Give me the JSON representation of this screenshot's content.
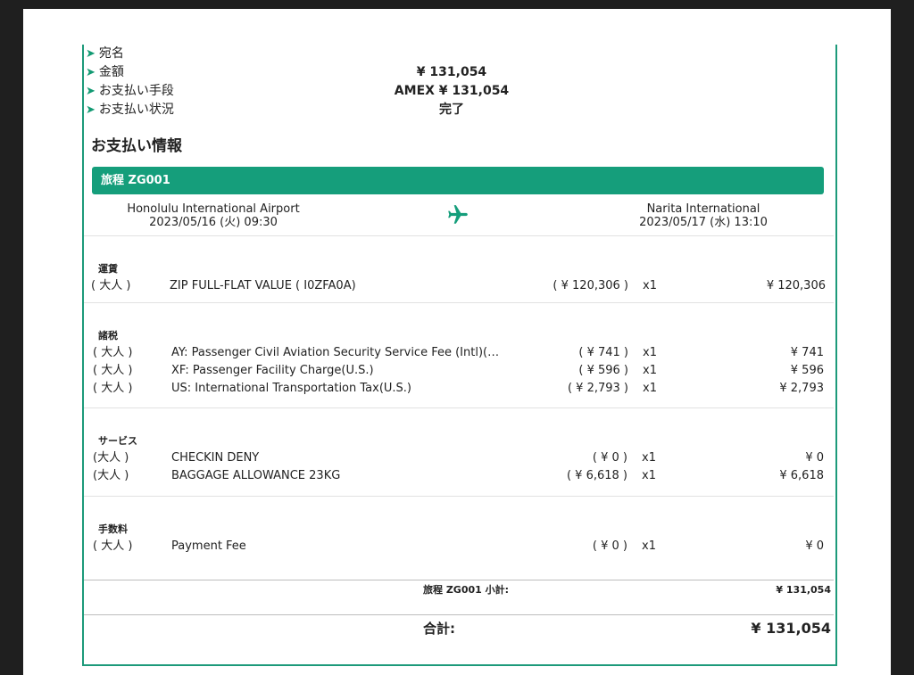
{
  "summary": {
    "rows": [
      {
        "label": "宛名",
        "value": ""
      },
      {
        "label": "金額",
        "value": "¥ 131,054"
      },
      {
        "label": "お支払い手段",
        "value": "AMEX ¥ 131,054"
      },
      {
        "label": "お支払い状況",
        "value": "完了"
      }
    ]
  },
  "section_title": "お支払い情報",
  "itinerary": {
    "title": "旅程 ZG001",
    "origin": {
      "airport": "Honolulu International Airport",
      "datetime": "2023/05/16 (火) 09:30"
    },
    "destination": {
      "airport": "Narita International",
      "datetime": "2023/05/17 (水) 13:10"
    },
    "plane_icon": "airplane-icon"
  },
  "fare": {
    "title": "運賃",
    "rows": [
      {
        "pax": "( 大人 )",
        "desc": "ZIP FULL-FLAT VALUE ( I0ZFA0A)",
        "unit": "( ¥ 120,306 )",
        "qty": "x1",
        "amount": "¥ 120,306"
      }
    ]
  },
  "taxes": {
    "title": "諸税",
    "rows": [
      {
        "pax": "( 大人 )",
        "desc": "AY: Passenger Civil Aviation Security Service Fee (Intl)(…",
        "unit": "( ¥ 741 )",
        "qty": "x1",
        "amount": "¥ 741"
      },
      {
        "pax": "( 大人 )",
        "desc": "XF: Passenger Facility Charge(U.S.)",
        "unit": "( ¥ 596 )",
        "qty": "x1",
        "amount": "¥ 596"
      },
      {
        "pax": "( 大人 )",
        "desc": "US: International Transportation Tax(U.S.)",
        "unit": "( ¥ 2,793 )",
        "qty": "x1",
        "amount": "¥ 2,793"
      }
    ]
  },
  "services": {
    "title": "サービス",
    "rows": [
      {
        "pax": "(大人 )",
        "desc": "CHECKIN DENY",
        "unit": "( ¥ 0 )",
        "qty": "x1",
        "amount": "¥ 0"
      },
      {
        "pax": "(大人 )",
        "desc": "BAGGAGE ALLOWANCE 23KG",
        "unit": "( ¥ 6,618 )",
        "qty": "x1",
        "amount": "¥ 6,618"
      }
    ]
  },
  "fees": {
    "title": "手数料",
    "rows": [
      {
        "pax": "( 大人 )",
        "desc": "Payment Fee",
        "unit": "( ¥ 0 )",
        "qty": "x1",
        "amount": "¥ 0"
      }
    ]
  },
  "subtotal": {
    "label": "旅程 ZG001 小計:",
    "value": "¥ 131,054"
  },
  "total": {
    "label": "合計:",
    "value": "¥ 131,054"
  },
  "colors": {
    "accent": "#159e7b",
    "arrow": "#129a73"
  }
}
